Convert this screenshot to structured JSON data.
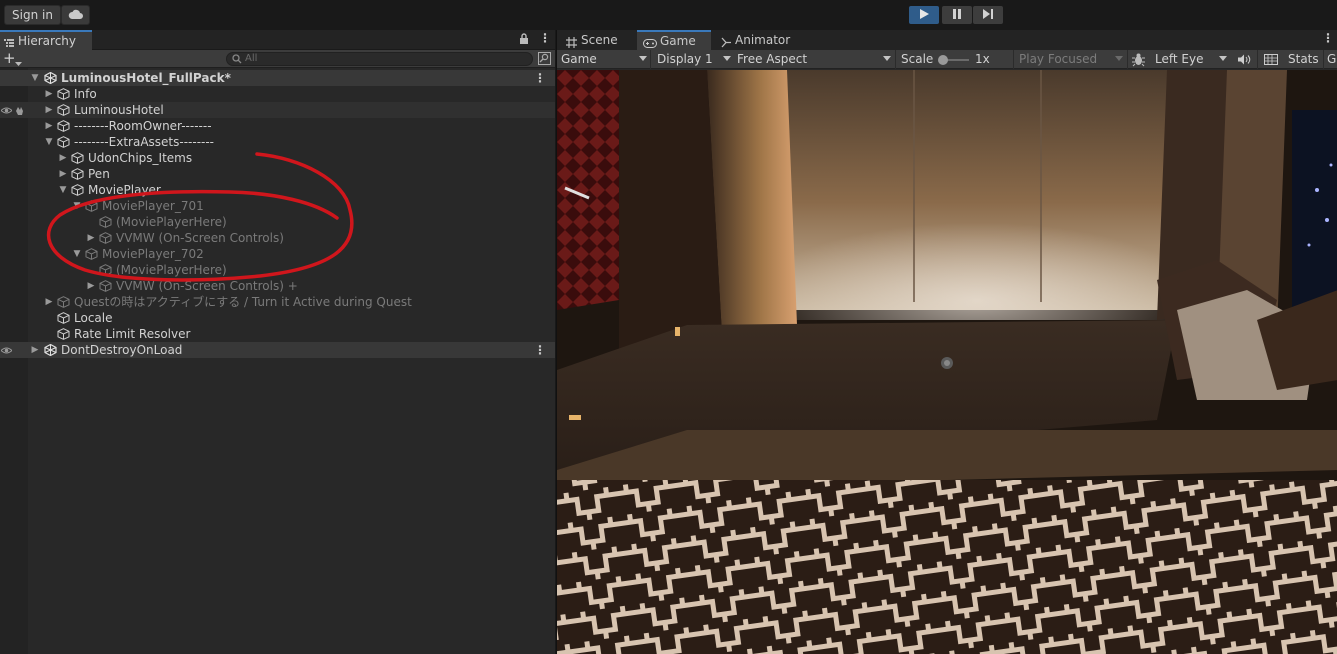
{
  "toolbar": {
    "sign_in": "Sign in"
  },
  "hierarchy": {
    "tab": "Hierarchy",
    "search_placeholder": "All",
    "scene": "LuminousHotel_FullPack*",
    "items": [
      "Info",
      "LuminousHotel",
      "--------RoomOwner-------",
      "--------ExtraAssets--------",
      "UdonChips_Items",
      "Pen",
      "MoviePlayer",
      "MoviePlayer_701",
      "(MoviePlayerHere)",
      "VVMW (On-Screen Controls)",
      "MoviePlayer_702",
      "(MoviePlayerHere)",
      "VVMW (On-Screen Controls) +",
      "Questの時はアクティブにする / Turn it Active during Quest",
      "Locale",
      "Rate Limit Resolver"
    ],
    "dont_destroy": "DontDestroyOnLoad"
  },
  "game": {
    "tabs": [
      "Scene",
      "Game",
      "Animator"
    ],
    "toolbar": {
      "view": "Game",
      "display": "Display 1",
      "aspect": "Free Aspect",
      "scale_label": "Scale",
      "scale_value": "1x",
      "play_mode": "Play Focused",
      "eye": "Left Eye",
      "stats": "Stats",
      "gizmos": "G"
    }
  },
  "colors": {
    "accent": "#3a79bb",
    "annotation": "#d0161c",
    "play_active": "#2f5c8a"
  }
}
